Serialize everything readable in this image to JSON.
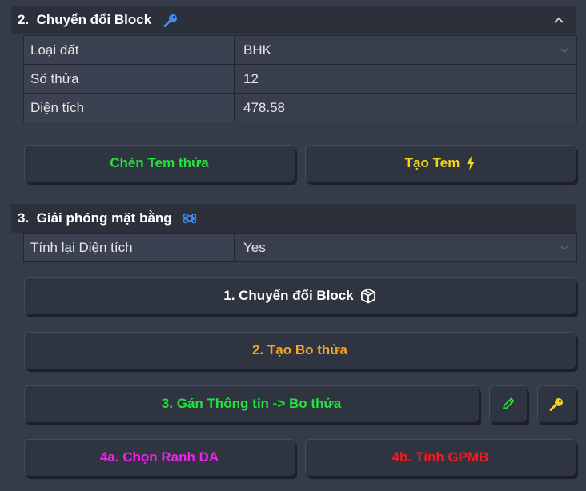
{
  "section2": {
    "title": "2.  Chuyển đổi Block",
    "rows": [
      {
        "label": "Loại đất",
        "value": "BHK"
      },
      {
        "label": "Số thửa",
        "value": "12"
      },
      {
        "label": "Diện tích",
        "value": "478.58"
      }
    ],
    "buttons": {
      "insert_label": "Chèn Tem thửa",
      "create_label": "Tạo Tem"
    }
  },
  "section3": {
    "title": "3.  Giải phóng mặt bằng",
    "rows": [
      {
        "label": "Tính lại Diện tích",
        "value": "Yes"
      }
    ],
    "buttons": {
      "convert_block_label": "1. Chuyển đổi Block",
      "create_boundary_label": "2. Tạo Bo thửa",
      "assign_info_label": "3. Gán Thông tin -> Bo thửa",
      "select_boundary_label": "4a. Chọn Ranh DA",
      "compute_gpmb_label": "4b. Tính GPMB"
    }
  },
  "colors": {
    "background": "#353b48",
    "header": "#2b303b",
    "green": "#22e33a",
    "yellow": "#f5d21c",
    "orange": "#f5a524",
    "magenta": "#ee22ee",
    "red": "#ee1c24",
    "blue": "#3a8ef0"
  }
}
